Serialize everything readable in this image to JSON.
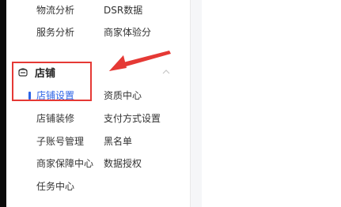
{
  "sidebar": {
    "top_rows": [
      {
        "left": "物流分析",
        "right": "DSR数据"
      },
      {
        "left": "服务分析",
        "right": "商家体验分"
      }
    ],
    "section_title": "店铺",
    "store_rows": [
      {
        "left": "店铺设置",
        "right": "资质中心"
      },
      {
        "left": "店铺装修",
        "right": "支付方式设置"
      },
      {
        "left": "子账号管理",
        "right": "黑名单"
      },
      {
        "left": "商家保障中心",
        "right": "数据授权"
      },
      {
        "left": "任务中心",
        "right": ""
      }
    ],
    "active_item": "店铺设置"
  },
  "annotation": {
    "box_color": "#e53935",
    "arrow_color": "#e53935"
  },
  "colors": {
    "accent": "#2b63e6",
    "text": "#333333"
  }
}
